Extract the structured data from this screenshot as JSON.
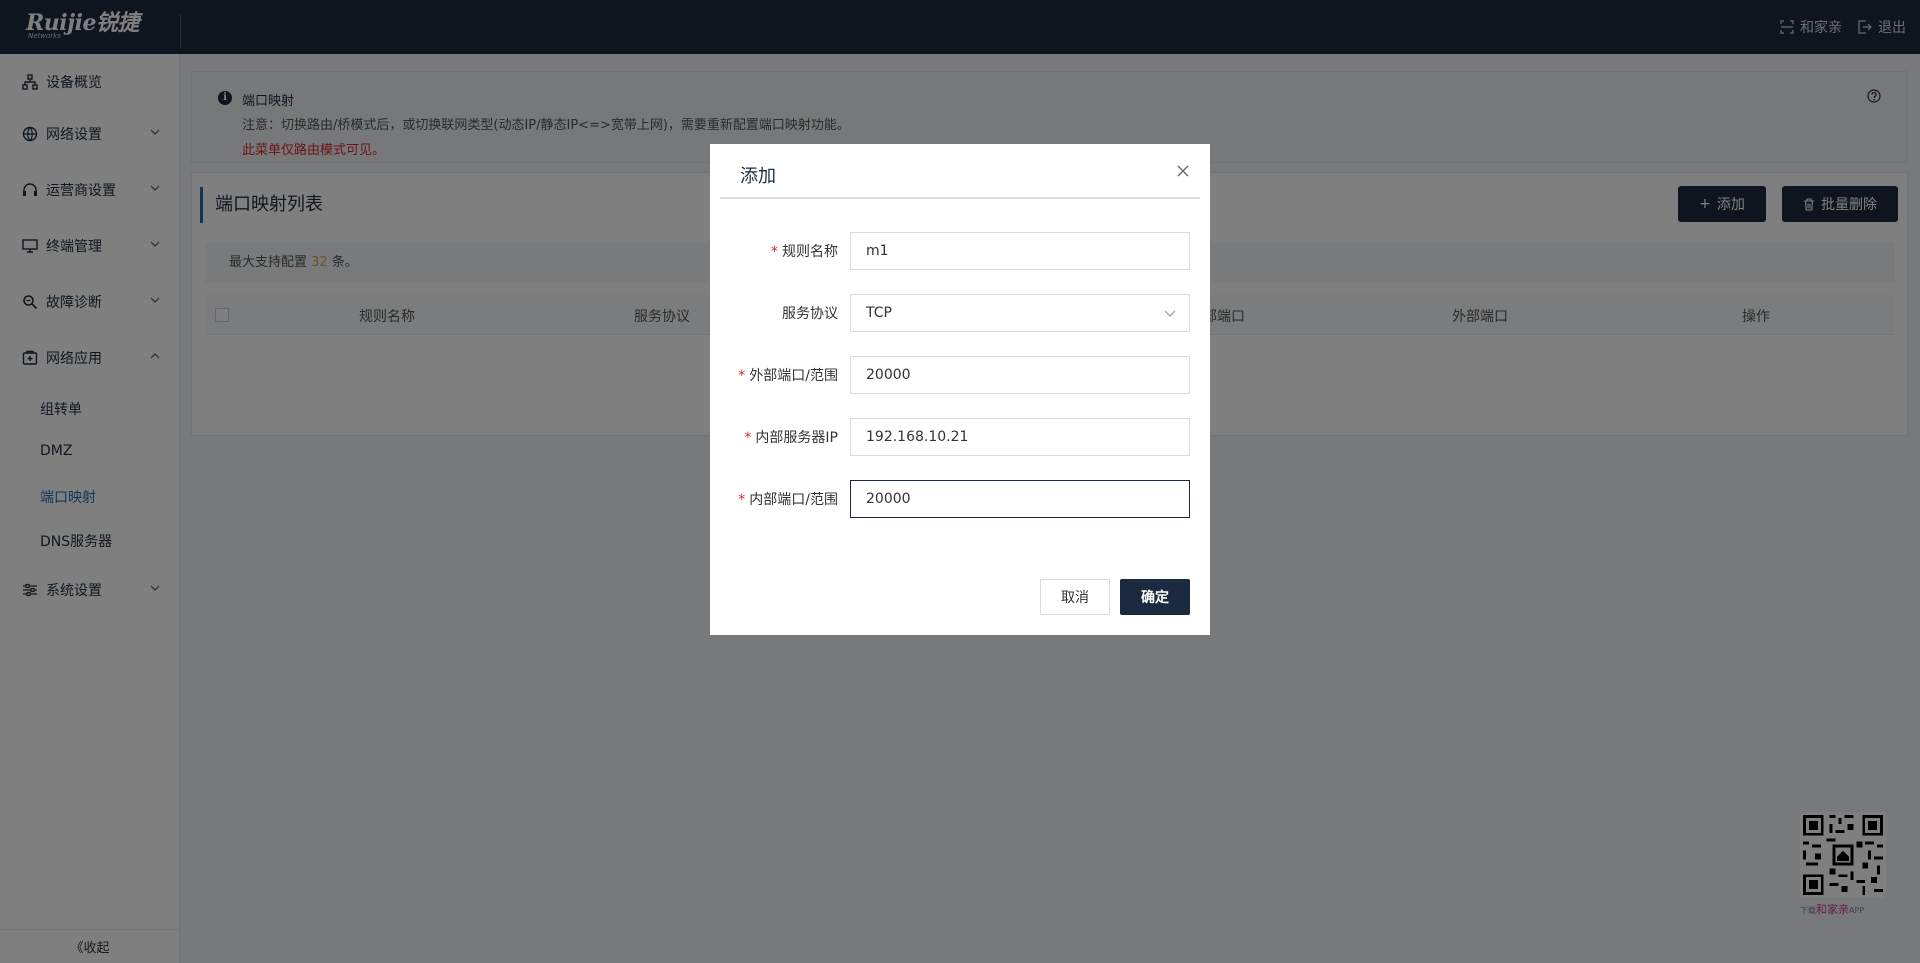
{
  "header": {
    "brand": "Ruijie锐捷",
    "brand_sub": "Networks",
    "actions": [
      {
        "label": "和家亲",
        "icon": "scan-icon"
      },
      {
        "label": "退出",
        "icon": "logout-icon"
      }
    ]
  },
  "sidebar": {
    "items": [
      {
        "label": "设备概览",
        "icon": "topology-icon"
      },
      {
        "label": "网络设置",
        "icon": "globe-icon"
      },
      {
        "label": "运营商设置",
        "icon": "headset-icon"
      },
      {
        "label": "终端管理",
        "icon": "monitor-icon"
      },
      {
        "label": "故障诊断",
        "icon": "diagnose-icon"
      },
      {
        "label": "网络应用",
        "icon": "app-icon"
      },
      {
        "label": "系统设置",
        "icon": "sliders-icon"
      }
    ],
    "sub_items": [
      {
        "label": "组转单"
      },
      {
        "label": "DMZ"
      },
      {
        "label": "端口映射",
        "active": true
      },
      {
        "label": "DNS服务器"
      }
    ],
    "collapse_label": "《收起"
  },
  "notice": {
    "title": "端口映射",
    "line1": "注意：切换路由/桥模式后，或切换联网类型(动态IP/静态IP<=>宽带上网)，需要重新配置端口映射功能。",
    "line2": "此菜单仅路由模式可见。"
  },
  "list": {
    "title": "端口映射列表",
    "add_label": "添加",
    "batch_delete_label": "批量删除",
    "limit_prefix": "最大支持配置",
    "limit_count": "32",
    "limit_suffix": "条。",
    "columns": [
      "规则名称",
      "服务协议",
      "部端口",
      "外部端口",
      "操作"
    ]
  },
  "qr": {
    "caption_small": "下载",
    "caption": "和家亲",
    "caption_app": "APP"
  },
  "modal": {
    "title": "添加",
    "fields": [
      {
        "label": "规则名称",
        "required": true,
        "value": "m1"
      },
      {
        "label": "服务协议",
        "required": false,
        "value": "TCP"
      },
      {
        "label": "外部端口/范围",
        "required": true,
        "value": "20000"
      },
      {
        "label": "内部服务器IP",
        "required": true,
        "value": "192.168.10.21"
      },
      {
        "label": "内部端口/范围",
        "required": true,
        "value": "20000"
      }
    ],
    "cancel_label": "取消",
    "ok_label": "确定"
  },
  "colors": {
    "header_bg": "#1c2a3f",
    "accent": "#1f6fb5",
    "warning_text": "#d9272e",
    "count_highlight": "#e6a23c"
  }
}
